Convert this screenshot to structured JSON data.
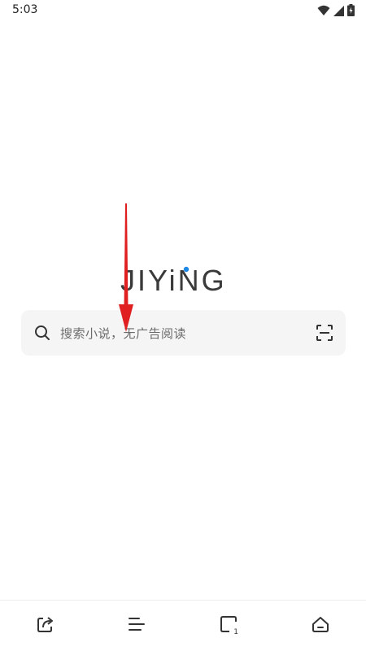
{
  "status_bar": {
    "time": "5:03",
    "icons": [
      "wifi-icon",
      "signal-icon",
      "battery-icon"
    ]
  },
  "logo": {
    "text": "JIYiNG"
  },
  "search": {
    "placeholder": "搜索小说，无广告阅读",
    "icons": [
      "search-icon",
      "scan-icon"
    ]
  },
  "bottom_nav": {
    "items": [
      {
        "name": "share",
        "icon": "share-icon"
      },
      {
        "name": "menu",
        "icon": "menu-icon"
      },
      {
        "name": "tabs",
        "icon": "tabs-icon",
        "count": "1"
      },
      {
        "name": "home",
        "icon": "home-icon"
      }
    ]
  },
  "colors": {
    "accent": "#1e88e5",
    "arrow": "#e02020",
    "logo": "#3a3a3a",
    "search_bg": "#f5f5f5"
  }
}
